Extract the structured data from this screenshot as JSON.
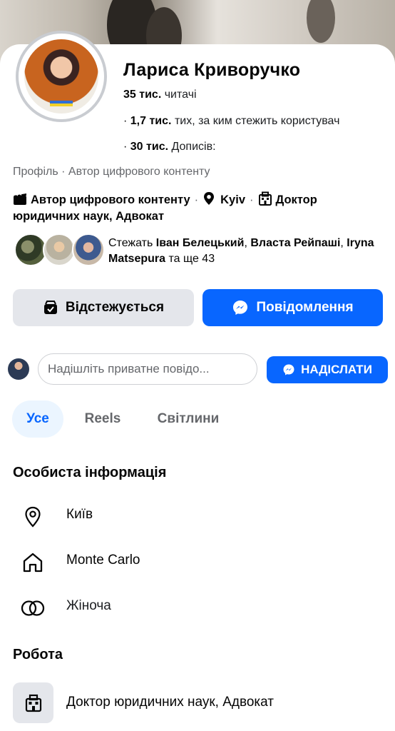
{
  "profile": {
    "name": "Лариса Криворучко",
    "followers_count": "35 тис.",
    "followers_label": "читачі",
    "following_count": "1,7 тис.",
    "following_label": "тих, за ким стежить користувач",
    "posts_count": "30 тис.",
    "posts_label": "Дописів:",
    "meta_line": "Профіль · Автор цифрового контенту"
  },
  "tags": {
    "category": "Автор цифрового контенту",
    "city": "Kyiv",
    "work": "Доктор юридичних наук, Адвокат"
  },
  "mutual": {
    "prefix": "Стежать ",
    "name1": "Іван Белецький",
    "name2": "Власта Рейпаші",
    "name3": "Iryna  Matsepura",
    "suffix": " та ще 43"
  },
  "actions": {
    "follow_label": "Відстежується",
    "message_label": "Повідомлення"
  },
  "private_message": {
    "placeholder": "Надішліть приватне повідо...",
    "send_label": "НАДІСЛАТИ"
  },
  "tabs": [
    {
      "label": "Усе"
    },
    {
      "label": "Reels"
    },
    {
      "label": "Світлини"
    }
  ],
  "personal": {
    "heading": "Особиста інформація",
    "items": [
      {
        "icon": "location-pin-icon",
        "label": "Київ"
      },
      {
        "icon": "home-icon",
        "label": "Monte Carlo"
      },
      {
        "icon": "gender-icon",
        "label": "Жіноча"
      }
    ]
  },
  "work": {
    "heading": "Робота",
    "item": "Доктор юридичних наук, Адвокат"
  },
  "colors": {
    "accent": "#0866ff",
    "button_gray": "#e4e6eb",
    "muted_text": "#65676b",
    "active_tab_bg": "#ebf5ff"
  }
}
